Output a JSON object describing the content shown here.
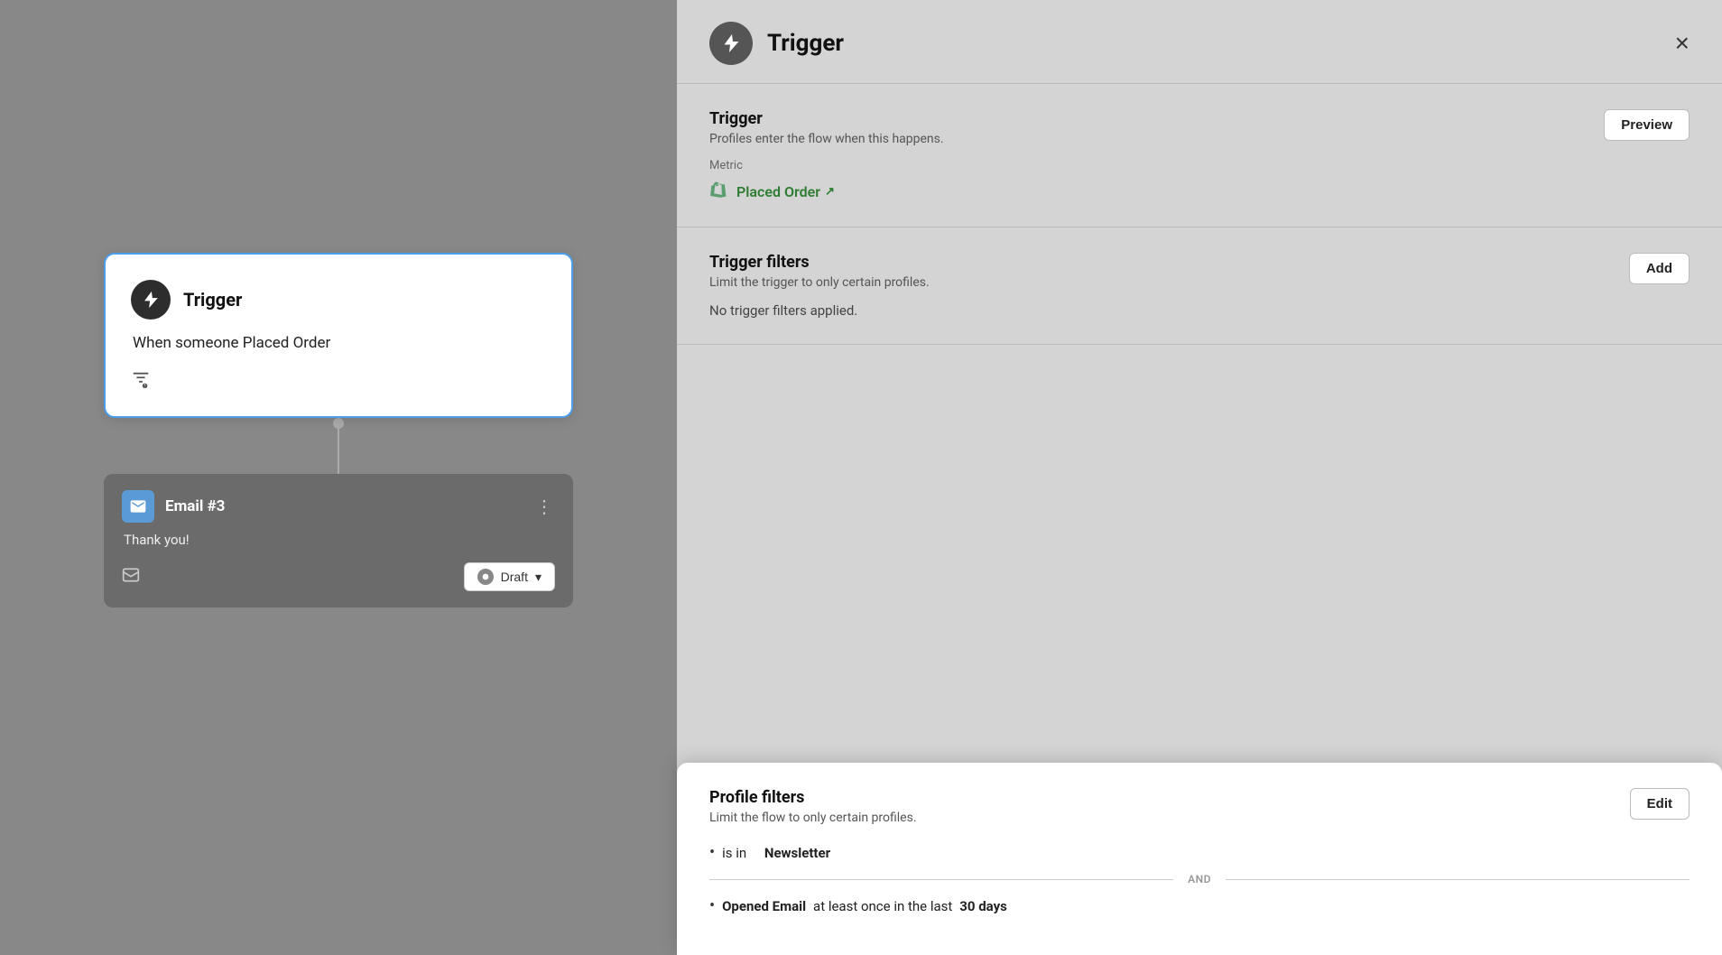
{
  "canvas": {
    "trigger_card": {
      "icon_label": "trigger-icon",
      "title": "Trigger",
      "body_text": "When someone Placed Order",
      "filter_icon_label": "filter-person-icon"
    },
    "email_card": {
      "title": "Email #3",
      "body_text": "Thank you!",
      "draft_button_label": "Draft",
      "more_options_label": "⋮"
    }
  },
  "right_panel": {
    "header": {
      "title": "Trigger",
      "close_label": "×"
    },
    "trigger_section": {
      "title": "Trigger",
      "subtitle": "Profiles enter the flow when this happens.",
      "preview_button": "Preview",
      "metric_label": "Metric",
      "metric_name": "Placed Order",
      "metric_icon": "shopify-icon"
    },
    "trigger_filters_section": {
      "title": "Trigger filters",
      "subtitle": "Limit the trigger to only certain profiles.",
      "add_button": "Add",
      "no_filters_text": "No trigger filters applied."
    },
    "profile_filters_section": {
      "title": "Profile filters",
      "subtitle": "Limit the flow to only certain profiles.",
      "edit_button": "Edit",
      "filter1_pre": "is in",
      "filter1_bold": "Newsletter",
      "and_label": "AND",
      "filter2_pre": "",
      "filter2_bold": "Opened Email",
      "filter2_post": " at least once in the last ",
      "filter2_bold2": "30 days"
    }
  }
}
